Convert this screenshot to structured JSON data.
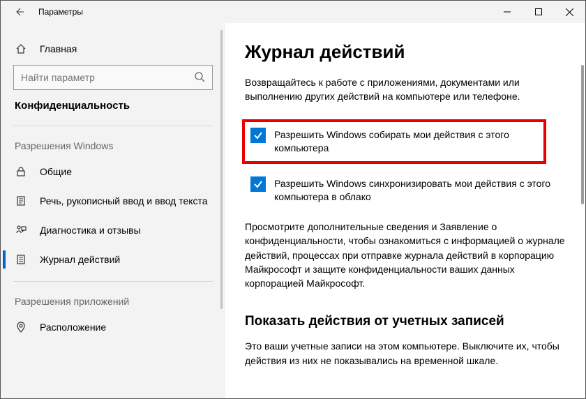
{
  "titlebar": {
    "title": "Параметры"
  },
  "sidebar": {
    "home": "Главная",
    "search_placeholder": "Найти параметр",
    "section_title": "Конфиденциальность",
    "group1_label": "Разрешения Windows",
    "group2_label": "Разрешения приложений",
    "items": [
      {
        "label": "Общие"
      },
      {
        "label": "Речь, рукописный ввод и ввод текста"
      },
      {
        "label": "Диагностика и отзывы"
      },
      {
        "label": "Журнал действий"
      }
    ],
    "items2": [
      {
        "label": "Расположение"
      }
    ]
  },
  "content": {
    "h1": "Журнал действий",
    "p1": "Возвращайтесь к работе с приложениями, документами или выполнению других действий на компьютере или телефоне.",
    "check1": "Разрешить Windows собирать мои действия с этого компьютера",
    "check2": "Разрешить Windows синхронизировать мои действия с этого компьютера в облако",
    "p2": "Просмотрите дополнительные сведения и Заявление о конфиденциальности, чтобы ознакомиться с информацией о журнале действий, процессах при отправке журнала действий в корпорацию Майкрософт и защите конфиденциальности ваших данных корпорацией Майкрософт.",
    "h2": "Показать действия от учетных записей",
    "p3": "Это ваши учетные записи на этом компьютере. Выключите их, чтобы действия из них не показывались на временной шкале."
  }
}
